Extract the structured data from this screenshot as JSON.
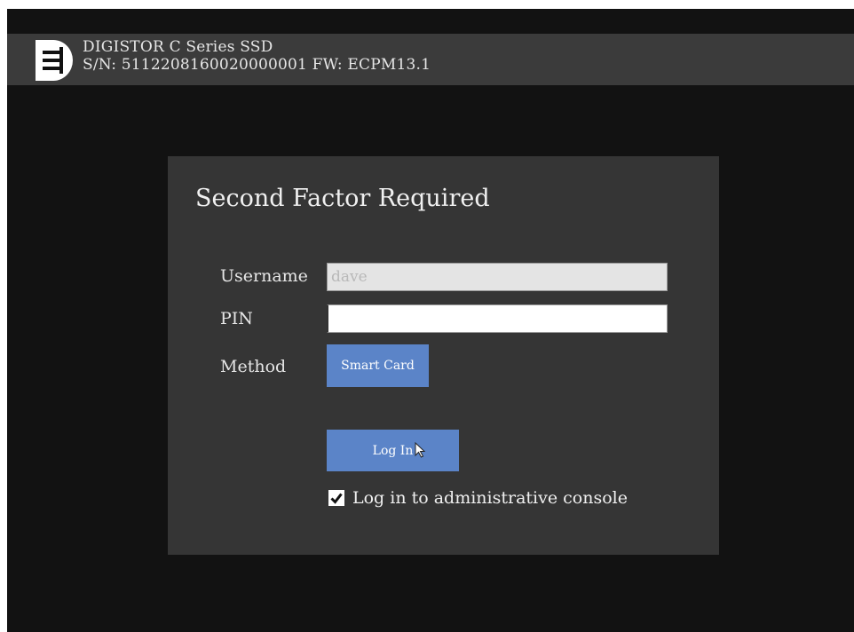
{
  "device": {
    "name": "DIGISTOR C Series SSD",
    "serial_line": "S/N: 5112208160020000001 FW: ECPM13.1"
  },
  "dialog": {
    "title": "Second Factor Required",
    "username_label": "Username",
    "username_value": "dave",
    "pin_label": "PIN",
    "pin_value": "",
    "method_label": "Method",
    "method_button": "Smart Card",
    "login_button": "Log In",
    "admin_console_label": "Log in to administrative console",
    "admin_console_checked": true
  },
  "colors": {
    "screen_bg": "#121212",
    "topbar_bg": "#3b3b3b",
    "panel_bg": "#353535",
    "button_blue": "#5b84c8"
  },
  "icons": {
    "logo": "digistor-logo-icon",
    "check": "checkmark-icon",
    "cursor": "mouse-pointer-icon"
  }
}
